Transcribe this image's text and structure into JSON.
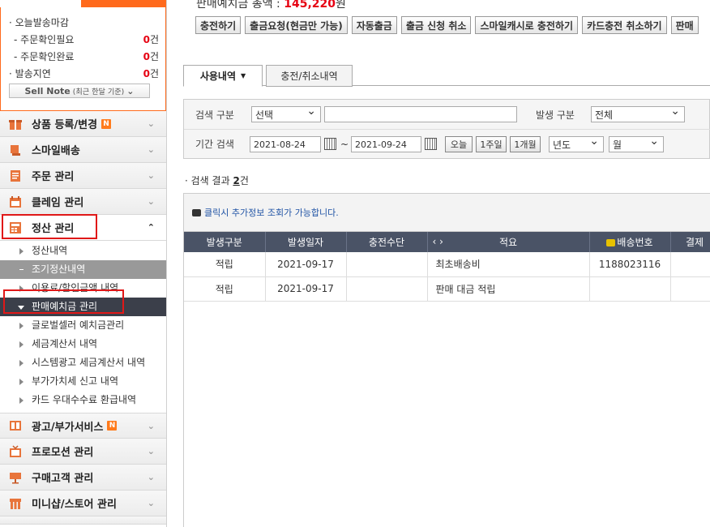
{
  "shipping": {
    "today_deadline": "오늘발송마감",
    "order_check_needed": "주문확인필요",
    "order_check_needed_count": "0",
    "order_check_done": "주문확인완료",
    "order_check_done_count": "0",
    "delayed": "발송지연",
    "delayed_count": "0",
    "unit": "건",
    "sell_note_label": "Sell Note",
    "sell_note_sub": "(최근 한달 기준)"
  },
  "sidebar": {
    "menus": [
      {
        "label": "상품 등록/변경",
        "badge": "N",
        "icon": "product-icon"
      },
      {
        "label": "스마일배송",
        "icon": "smile-delivery-icon"
      },
      {
        "label": "주문 관리",
        "icon": "order-icon"
      },
      {
        "label": "클레임 관리",
        "icon": "claim-icon"
      },
      {
        "label": "정산 관리",
        "icon": "settlement-icon"
      }
    ],
    "settlement_sub": [
      "정산내역",
      "조기정산내역",
      "이용료/할인금액 내역",
      "판매예치금 관리",
      "글로벌셀러 예치금관리",
      "세금계산서 내역",
      "시스템광고 세금계산서 내역",
      "부가가치세 신고 내역",
      "카드 우대수수료 환급내역"
    ],
    "menus_after": [
      {
        "label": "광고/부가서비스",
        "badge": "N",
        "icon": "ad-icon"
      },
      {
        "label": "프로모션 관리",
        "icon": "promotion-icon"
      },
      {
        "label": "구매고객 관리",
        "icon": "customer-icon"
      },
      {
        "label": "미니샵/스토어 관리",
        "icon": "store-icon"
      }
    ]
  },
  "header": {
    "balance_label": "판매예치금 총액 :",
    "balance_value": "145,220",
    "balance_unit": "원"
  },
  "toolbar": {
    "buttons": [
      "충전하기",
      "출금요청(현금만 가능)",
      "자동출금",
      "출금 신청 취소",
      "스마일캐시로 충전하기",
      "카드충전 취소하기",
      "판매"
    ]
  },
  "tabs": [
    "사용내역",
    "충전/취소내역"
  ],
  "search": {
    "type_label": "검색 구분",
    "type_value": "선택",
    "keyword_value": "",
    "occur_label": "발생 구분",
    "occur_value": "전체",
    "period_label": "기간 검색",
    "date_from": "2021-08-24",
    "date_sep": "~",
    "date_to": "2021-09-24",
    "btn_today": "오늘",
    "btn_week": "1주일",
    "btn_month": "1개월",
    "year_value": "년도",
    "month_value": "월"
  },
  "result": {
    "prefix": "검색 결과",
    "count": "2",
    "suffix": "건"
  },
  "grid": {
    "info": "클릭시 추가정보 조회가 가능합니다.",
    "columns": [
      "발생구분",
      "발생일자",
      "충전수단",
      "적요",
      "배송번호",
      "결제"
    ],
    "rows": [
      [
        "적립",
        "2021-09-17",
        "",
        "최초배송비",
        "1188023116",
        "("
      ],
      [
        "적립",
        "2021-09-17",
        "",
        "판매 대금 적립",
        "",
        ""
      ]
    ]
  }
}
